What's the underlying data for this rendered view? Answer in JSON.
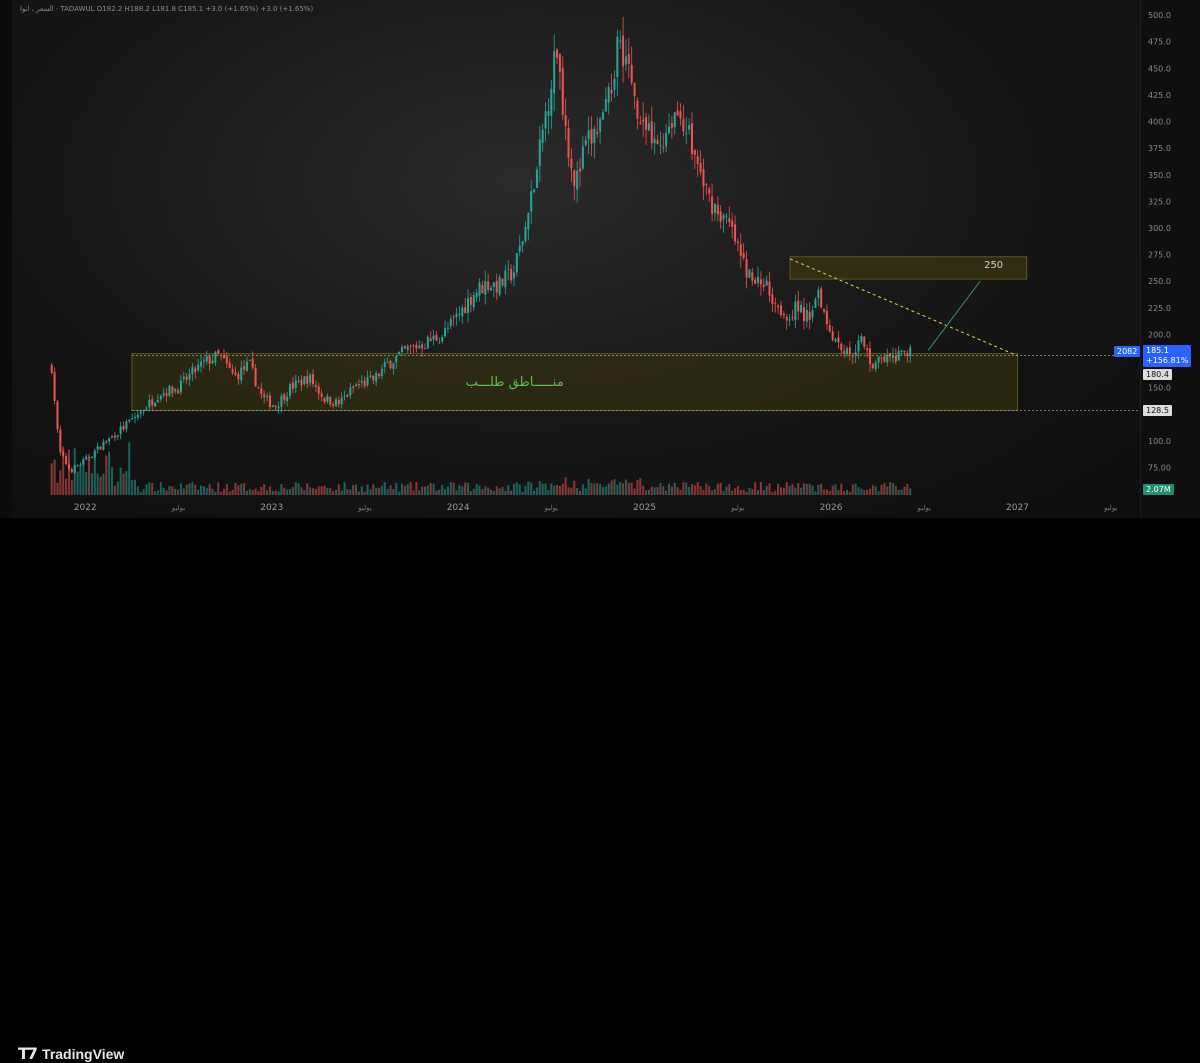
{
  "header": {
    "legend": "السعر ، انوا · TADAWUL  O182.2  H188.2  L181.8  C185.1  +3.0 (+1.65%)  +3.0 (+1.65%)"
  },
  "footer": {
    "brand": "TradingView"
  },
  "colors": {
    "up": "#26a69a",
    "down": "#ef5350",
    "zone_fill": "#3a3410",
    "zone_border": "#6b6320",
    "trend": "#e8d44d",
    "target_line": "#3f8f7a",
    "price_tag": "#2962ff"
  },
  "tags": {
    "volume_badge": "2082",
    "last_price": "185.1",
    "last_change": "+156.81%",
    "level_a": "180.4",
    "level_b": "128.5",
    "volume_total": "2.07M"
  },
  "annotations": {
    "zone_label": "منـــــاطق طلـــب",
    "target_label": "250"
  },
  "chart_data": {
    "type": "candlestick",
    "title": "",
    "y_axis_ticks": [
      "500.0",
      "475.0",
      "450.0",
      "425.0",
      "400.0",
      "375.0",
      "350.0",
      "325.0",
      "300.0",
      "275.0",
      "250.0",
      "225.0",
      "200.0",
      "175.0",
      "150.0",
      "100.0",
      "75.00"
    ],
    "ylim": [
      52,
      502
    ],
    "x_labels": [
      {
        "label": "2022",
        "kind": "year",
        "t": 2022.0
      },
      {
        "label": "يوليو",
        "kind": "mid",
        "t": 2022.5
      },
      {
        "label": "2023",
        "kind": "year",
        "t": 2023.0
      },
      {
        "label": "يوليو",
        "kind": "mid",
        "t": 2023.5
      },
      {
        "label": "2024",
        "kind": "year",
        "t": 2024.0
      },
      {
        "label": "يوليو",
        "kind": "mid",
        "t": 2024.5
      },
      {
        "label": "2025",
        "kind": "year",
        "t": 2025.0
      },
      {
        "label": "يوليو",
        "kind": "mid",
        "t": 2025.5
      },
      {
        "label": "2026",
        "kind": "year",
        "t": 2026.0
      },
      {
        "label": "يوليو",
        "kind": "mid",
        "t": 2026.5
      },
      {
        "label": "2027",
        "kind": "year",
        "t": 2027.0
      },
      {
        "label": "يوليو",
        "kind": "mid",
        "t": 2027.5
      }
    ],
    "xlim": [
      2021.8,
      2027.55
    ],
    "price_path": [
      {
        "t": 2021.82,
        "p": 170
      },
      {
        "t": 2021.86,
        "p": 90
      },
      {
        "t": 2021.92,
        "p": 72
      },
      {
        "t": 2022.0,
        "p": 82
      },
      {
        "t": 2022.1,
        "p": 98
      },
      {
        "t": 2022.2,
        "p": 112
      },
      {
        "t": 2022.3,
        "p": 128
      },
      {
        "t": 2022.4,
        "p": 145
      },
      {
        "t": 2022.5,
        "p": 150
      },
      {
        "t": 2022.58,
        "p": 165
      },
      {
        "t": 2022.65,
        "p": 175
      },
      {
        "t": 2022.72,
        "p": 180
      },
      {
        "t": 2022.8,
        "p": 160
      },
      {
        "t": 2022.88,
        "p": 172
      },
      {
        "t": 2022.95,
        "p": 140
      },
      {
        "t": 2023.02,
        "p": 133
      },
      {
        "t": 2023.1,
        "p": 150
      },
      {
        "t": 2023.2,
        "p": 160
      },
      {
        "t": 2023.28,
        "p": 140
      },
      {
        "t": 2023.36,
        "p": 135
      },
      {
        "t": 2023.45,
        "p": 152
      },
      {
        "t": 2023.55,
        "p": 158
      },
      {
        "t": 2023.62,
        "p": 172
      },
      {
        "t": 2023.72,
        "p": 185
      },
      {
        "t": 2023.82,
        "p": 192
      },
      {
        "t": 2023.92,
        "p": 200
      },
      {
        "t": 2024.0,
        "p": 218
      },
      {
        "t": 2024.08,
        "p": 238
      },
      {
        "t": 2024.15,
        "p": 248
      },
      {
        "t": 2024.22,
        "p": 246
      },
      {
        "t": 2024.3,
        "p": 260
      },
      {
        "t": 2024.36,
        "p": 300
      },
      {
        "t": 2024.42,
        "p": 350
      },
      {
        "t": 2024.48,
        "p": 420
      },
      {
        "t": 2024.53,
        "p": 470
      },
      {
        "t": 2024.58,
        "p": 390
      },
      {
        "t": 2024.63,
        "p": 340
      },
      {
        "t": 2024.68,
        "p": 375
      },
      {
        "t": 2024.74,
        "p": 390
      },
      {
        "t": 2024.8,
        "p": 410
      },
      {
        "t": 2024.86,
        "p": 480
      },
      {
        "t": 2024.9,
        "p": 460
      },
      {
        "t": 2024.95,
        "p": 420
      },
      {
        "t": 2025.0,
        "p": 395
      },
      {
        "t": 2025.05,
        "p": 375
      },
      {
        "t": 2025.1,
        "p": 385
      },
      {
        "t": 2025.16,
        "p": 410
      },
      {
        "t": 2025.22,
        "p": 400
      },
      {
        "t": 2025.28,
        "p": 360
      },
      {
        "t": 2025.34,
        "p": 330
      },
      {
        "t": 2025.4,
        "p": 315
      },
      {
        "t": 2025.46,
        "p": 300
      },
      {
        "t": 2025.52,
        "p": 270
      },
      {
        "t": 2025.58,
        "p": 248
      },
      {
        "t": 2025.64,
        "p": 250
      },
      {
        "t": 2025.7,
        "p": 232
      },
      {
        "t": 2025.76,
        "p": 218
      },
      {
        "t": 2025.82,
        "p": 225
      },
      {
        "t": 2025.88,
        "p": 215
      },
      {
        "t": 2025.93,
        "p": 245
      },
      {
        "t": 2025.98,
        "p": 210
      },
      {
        "t": 2026.04,
        "p": 192
      },
      {
        "t": 2026.1,
        "p": 180
      },
      {
        "t": 2026.16,
        "p": 195
      },
      {
        "t": 2026.22,
        "p": 172
      },
      {
        "t": 2026.28,
        "p": 178
      },
      {
        "t": 2026.34,
        "p": 176
      },
      {
        "t": 2026.4,
        "p": 182
      },
      {
        "t": 2026.44,
        "p": 185.1
      }
    ],
    "demand_zone": {
      "t1": 2022.25,
      "t2": 2027.0,
      "p_low": 128.5,
      "p_high": 182
    },
    "target_zone": {
      "t1": 2025.78,
      "t2": 2027.05,
      "p_low": 252,
      "p_high": 273
    },
    "trendline": {
      "t1": 2025.78,
      "p1": 271,
      "t2": 2027.0,
      "p2": 180
    },
    "target_arrow": {
      "t1": 2026.52,
      "p1": 185,
      "t2": 2026.8,
      "p2": 250
    },
    "ref_levels": [
      180.4,
      128.5
    ]
  }
}
